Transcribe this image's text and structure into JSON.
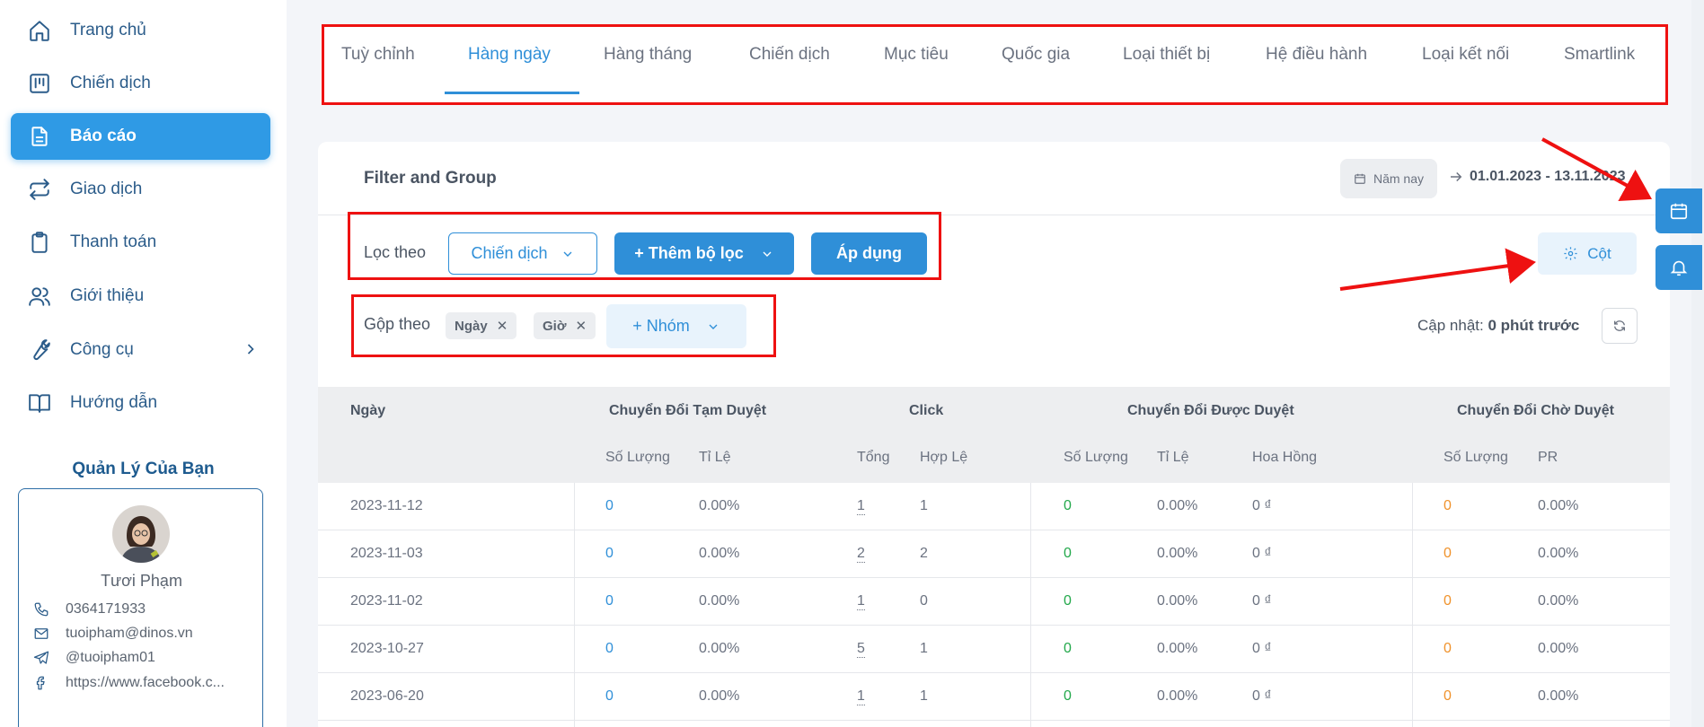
{
  "sidebar": {
    "items": [
      {
        "label": "Trang chủ",
        "icon": "home-icon"
      },
      {
        "label": "Chiến dịch",
        "icon": "board-icon"
      },
      {
        "label": "Báo cáo",
        "icon": "document-icon",
        "active": true
      },
      {
        "label": "Giao dịch",
        "icon": "swap-icon"
      },
      {
        "label": "Thanh toán",
        "icon": "clipboard-icon"
      },
      {
        "label": "Giới thiệu",
        "icon": "users-icon"
      },
      {
        "label": "Công cụ",
        "icon": "wrench-icon",
        "has_submenu": true
      },
      {
        "label": "Hướng dẫn",
        "icon": "book-icon"
      }
    ],
    "manager": {
      "title": "Quản Lý Của Bạn",
      "name": "Tươi Phạm",
      "phone": "0364171933",
      "email": "tuoipham@dinos.vn",
      "telegram": "@tuoipham01",
      "facebook": "https://www.facebook.c..."
    }
  },
  "tabs": [
    {
      "label": "Tuỳ chỉnh"
    },
    {
      "label": "Hàng ngày",
      "active": true
    },
    {
      "label": "Hàng tháng"
    },
    {
      "label": "Chiến dịch"
    },
    {
      "label": "Mục tiêu"
    },
    {
      "label": "Quốc gia"
    },
    {
      "label": "Loại thiết bị"
    },
    {
      "label": "Hệ điều hành"
    },
    {
      "label": "Loại kết nối"
    },
    {
      "label": "Smartlink"
    }
  ],
  "filter": {
    "title": "Filter and Group",
    "date_preset": "Năm nay",
    "date_range": "01.01.2023 - 13.11.2023",
    "filter_label": "Lọc theo",
    "filter_select": "Chiến dịch",
    "add_filter": "+ Thêm bộ lọc",
    "apply": "Áp dụng",
    "columns": "Cột",
    "group_label": "Gộp theo",
    "group_chips": [
      "Ngày",
      "Giờ"
    ],
    "group_add": "+ Nhóm",
    "update_label": "Cập nhật:",
    "update_value": "0 phút trước"
  },
  "table": {
    "groups": {
      "date": "Ngày",
      "pending": "Chuyển Đổi Tạm Duyệt",
      "click": "Click",
      "approved": "Chuyển Đổi Được Duyệt",
      "waiting": "Chuyển Đổi Chờ Duyệt"
    },
    "subheaders": {
      "p_qty": "Số Lượng",
      "p_rate": "Tỉ Lệ",
      "c_total": "Tổng",
      "c_valid": "Hợp Lệ",
      "a_qty": "Số Lượng",
      "a_rate": "Tỉ Lệ",
      "a_comm": "Hoa Hồng",
      "w_qty": "Số Lượng",
      "w_pr": "PR"
    },
    "rows": [
      [
        "2023-11-12",
        "0",
        "0.00%",
        "1",
        "1",
        "0",
        "0.00%",
        "0 ₫",
        "0",
        "0.00%"
      ],
      [
        "2023-11-03",
        "0",
        "0.00%",
        "2",
        "2",
        "0",
        "0.00%",
        "0 ₫",
        "0",
        "0.00%"
      ],
      [
        "2023-11-02",
        "0",
        "0.00%",
        "1",
        "0",
        "0",
        "0.00%",
        "0 ₫",
        "0",
        "0.00%"
      ],
      [
        "2023-10-27",
        "0",
        "0.00%",
        "5",
        "1",
        "0",
        "0.00%",
        "0 ₫",
        "0",
        "0.00%"
      ],
      [
        "2023-06-20",
        "0",
        "0.00%",
        "1",
        "1",
        "0",
        "0.00%",
        "0 ₫",
        "0",
        "0.00%"
      ]
    ]
  },
  "floating": [
    {
      "icon": "calendar-icon"
    },
    {
      "icon": "bell-icon"
    }
  ],
  "colors": {
    "accent": "#2f8fd8",
    "sidebar_active": "#2f9ae5",
    "nav_text": "#2b5c8a",
    "annotation": "#ee1111",
    "approved": "#22a84a",
    "waiting": "#f0922b"
  }
}
